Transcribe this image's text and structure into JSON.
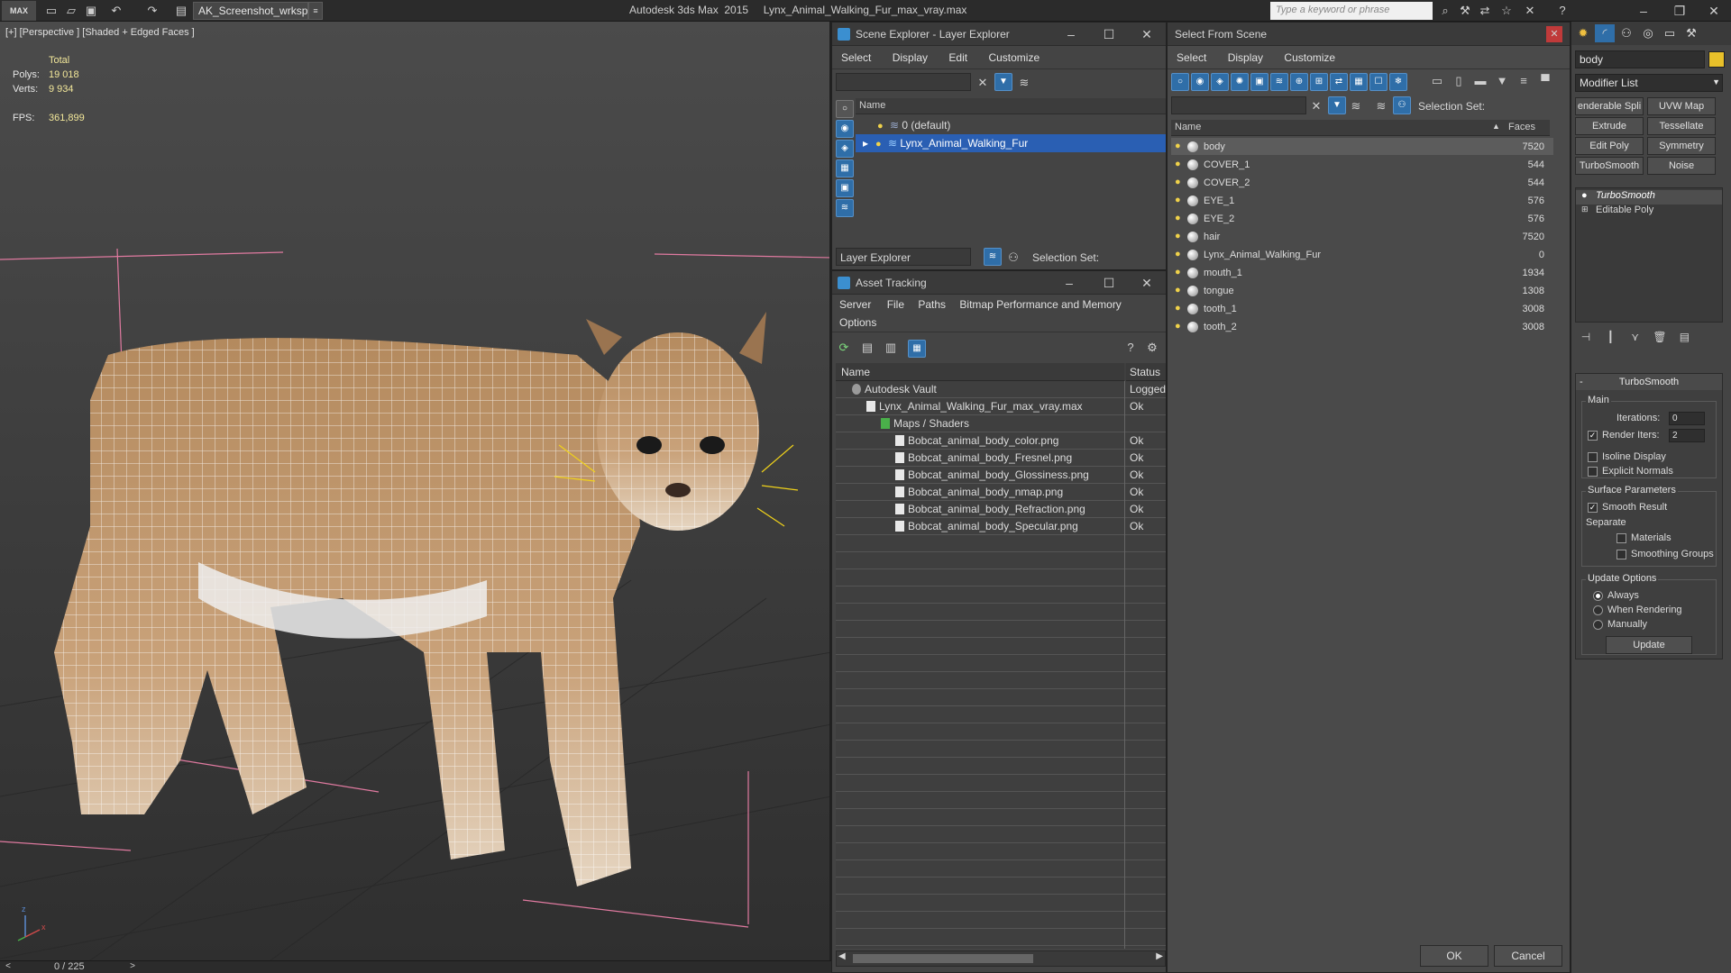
{
  "app": {
    "logo": "MAX",
    "workspace": "AK_Screenshot_wrksp",
    "title": "Autodesk 3ds Max  2015     Lynx_Animal_Walking_Fur_max_vray.max",
    "search_placeholder": "Type a keyword or phrase"
  },
  "viewport": {
    "label": "[+] [Perspective ] [Shaded + Edged Faces ]",
    "stats": {
      "total_label": "Total",
      "polys_label": "Polys:",
      "polys": "19 018",
      "verts_label": "Verts:",
      "verts": "9 934",
      "fps_label": "FPS:",
      "fps": "361,899"
    },
    "timeline": "0 / 225",
    "prev": "<",
    "next": ">"
  },
  "scene_explorer": {
    "title": "Scene Explorer - Layer Explorer",
    "menu": [
      "Select",
      "Display",
      "Edit",
      "Customize"
    ],
    "column": "Name",
    "layers": [
      "0 (default)",
      "Lynx_Animal_Walking_Fur"
    ],
    "footer_mode": "Layer Explorer",
    "selection_set": "Selection Set:"
  },
  "asset_tracking": {
    "title": "Asset Tracking",
    "menu": [
      "Server",
      "File",
      "Paths",
      "Bitmap Performance and Memory"
    ],
    "menu2": [
      "Options"
    ],
    "col_name": "Name",
    "col_status": "Status",
    "rows": [
      {
        "name": "Autodesk Vault",
        "status": "Logged",
        "indent": 0
      },
      {
        "name": "Lynx_Animal_Walking_Fur_max_vray.max",
        "status": "Ok",
        "indent": 1
      },
      {
        "name": "Maps / Shaders",
        "status": "",
        "indent": 2
      },
      {
        "name": "Bobcat_animal_body_color.png",
        "status": "Ok",
        "indent": 3
      },
      {
        "name": "Bobcat_animal_body_Fresnel.png",
        "status": "Ok",
        "indent": 3
      },
      {
        "name": "Bobcat_animal_body_Glossiness.png",
        "status": "Ok",
        "indent": 3
      },
      {
        "name": "Bobcat_animal_body_nmap.png",
        "status": "Ok",
        "indent": 3
      },
      {
        "name": "Bobcat_animal_body_Refraction.png",
        "status": "Ok",
        "indent": 3
      },
      {
        "name": "Bobcat_animal_body_Specular.png",
        "status": "Ok",
        "indent": 3
      }
    ]
  },
  "select_from_scene": {
    "title": "Select From Scene",
    "menu": [
      "Select",
      "Display",
      "Customize"
    ],
    "selection_set": "Selection Set:",
    "col_name": "Name",
    "col_faces": "Faces",
    "rows": [
      {
        "name": "body",
        "faces": "7520"
      },
      {
        "name": "COVER_1",
        "faces": "544"
      },
      {
        "name": "COVER_2",
        "faces": "544"
      },
      {
        "name": "EYE_1",
        "faces": "576"
      },
      {
        "name": "EYE_2",
        "faces": "576"
      },
      {
        "name": "hair",
        "faces": "7520"
      },
      {
        "name": "Lynx_Animal_Walking_Fur",
        "faces": "0"
      },
      {
        "name": "mouth_1",
        "faces": "1934"
      },
      {
        "name": "tongue",
        "faces": "1308"
      },
      {
        "name": "tooth_1",
        "faces": "3008"
      },
      {
        "name": "tooth_2",
        "faces": "3008"
      }
    ],
    "ok": "OK",
    "cancel": "Cancel"
  },
  "command_panel": {
    "object_name": "body",
    "modifier_list": "Modifier List",
    "buttons": [
      "enderable Spli",
      "UVW Map",
      "Extrude",
      "Tessellate",
      "Edit Poly",
      "Symmetry",
      "TurboSmooth",
      "Noise"
    ],
    "stack": [
      "TurboSmooth",
      "Editable Poly"
    ],
    "rollout_title": "TurboSmooth",
    "main_label": "Main",
    "iterations_label": "Iterations:",
    "iterations": "0",
    "render_iters_label": "Render Iters:",
    "render_iters": "2",
    "isoline": "Isoline Display",
    "explicit_normals": "Explicit Normals",
    "surface_params": "Surface Parameters",
    "smooth_result": "Smooth Result",
    "separate": "Separate",
    "materials": "Materials",
    "smoothing_groups": "Smoothing Groups",
    "update_options": "Update Options",
    "always": "Always",
    "when_rendering": "When Rendering",
    "manually": "Manually",
    "update": "Update"
  }
}
